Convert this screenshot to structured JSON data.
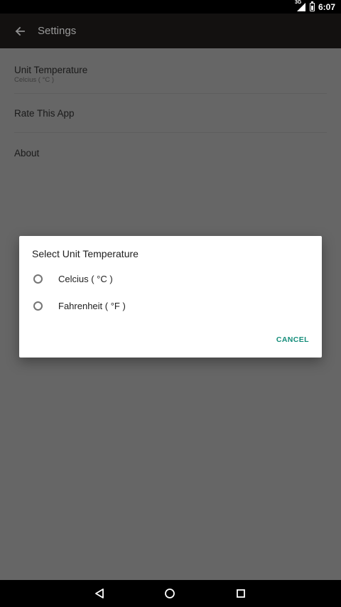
{
  "status_bar": {
    "time": "6:07",
    "network": "3G",
    "signal_icon": "cell-signal-icon",
    "battery_icon": "battery-icon"
  },
  "app_bar": {
    "title": "Settings",
    "back_icon": "arrow-back-icon"
  },
  "settings": {
    "items": [
      {
        "title": "Unit Temperature",
        "subtitle": "Celcius ( °C )"
      },
      {
        "title": "Rate This App"
      },
      {
        "title": "About"
      }
    ]
  },
  "dialog": {
    "title": "Select Unit Temperature",
    "options": [
      {
        "label": "Celcius ( °C )",
        "selected": false
      },
      {
        "label": "Fahrenheit ( °F )",
        "selected": false
      }
    ],
    "cancel_label": "CANCEL",
    "accent_color": "#148d7a"
  },
  "nav_bar": {
    "back_icon": "nav-back-icon",
    "home_icon": "nav-home-icon",
    "recents_icon": "nav-recents-icon"
  }
}
